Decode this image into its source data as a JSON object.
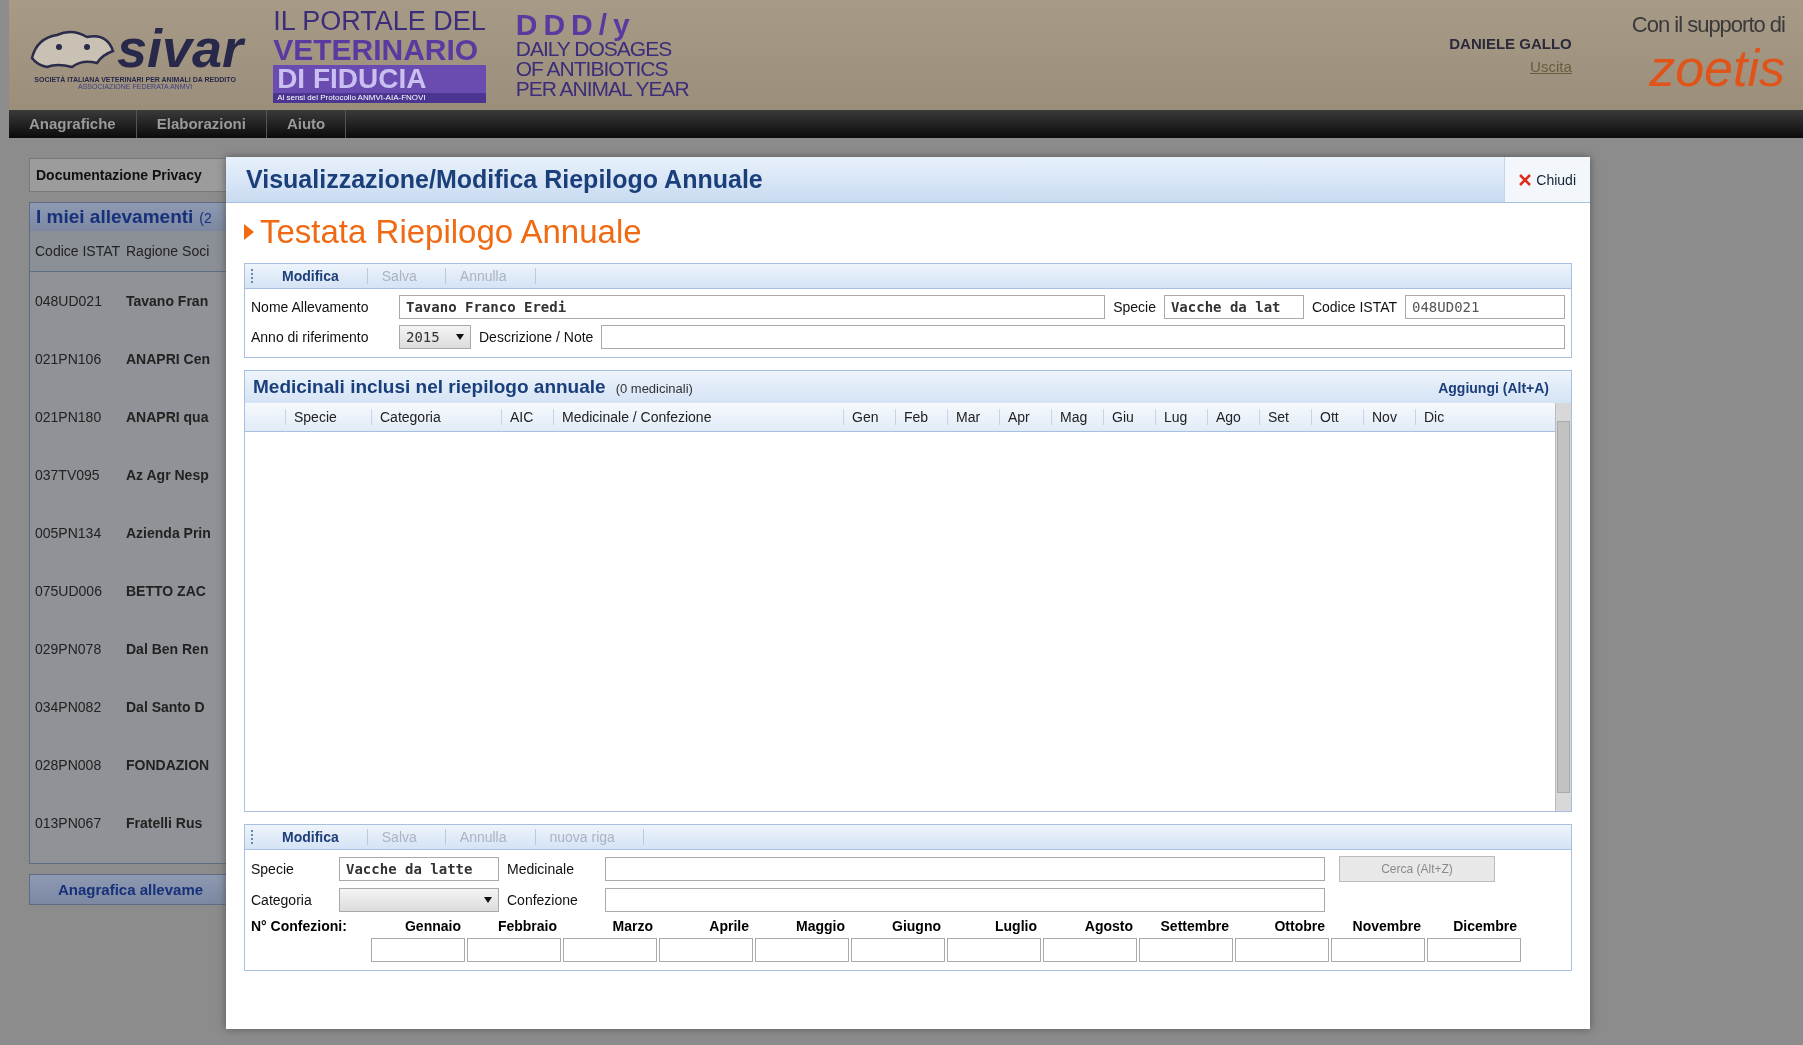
{
  "header": {
    "sivar_logo": {
      "name": "sivar",
      "subtitle": "SOCIETÀ ITALIANA VETERINARI PER ANIMALI DA REDDITO",
      "federation": "ASSOCIAZIONE FEDERATA ANMVI"
    },
    "portal_logo": {
      "line_1": "IL PORTALE DEL",
      "line_2": "VETERINARIO",
      "line_3": "DI FIDUCIA",
      "caption": "Al sensi del Protocollo ANMVI-AIA-FNOVI"
    },
    "ddd_logo": {
      "title": "DDD/y",
      "lines": [
        "DAILY DOSAGES",
        "OF ANTIBIOTICS",
        "PER ANIMAL YEAR"
      ]
    },
    "user": "DANIELE GALLO",
    "logout": "Uscita",
    "sponsor_caption": "Con il supporto di",
    "sponsor": "zoetis"
  },
  "menu": [
    "Anagrafiche",
    "Elaborazioni",
    "Aiuto"
  ],
  "sidebar": {
    "privacy": "Documentazione Privacy",
    "title": "I miei allevamenti",
    "count": "(2",
    "columns": [
      "Codice ISTAT",
      "Ragione Soci"
    ],
    "rows": [
      {
        "code": "048UD021",
        "name": "Tavano Fran"
      },
      {
        "code": "021PN106",
        "name": "ANAPRI Cen"
      },
      {
        "code": "021PN180",
        "name": "ANAPRI qua"
      },
      {
        "code": "037TV095",
        "name": "Az Agr Nesp"
      },
      {
        "code": "005PN134",
        "name": "Azienda Prin"
      },
      {
        "code": "075UD006",
        "name": "BETTO ZAC"
      },
      {
        "code": "029PN078",
        "name": "Dal Ben Ren"
      },
      {
        "code": "034PN082",
        "name": "Dal Santo D"
      },
      {
        "code": "028PN008",
        "name": "FONDAZION"
      },
      {
        "code": "013PN067",
        "name": "Fratelli Rus"
      }
    ],
    "button": "Anagrafica allevame"
  },
  "dialog": {
    "title": "Visualizzazione/Modifica Riepilogo Annuale",
    "close": "Chiudi",
    "heading": "Testata Riepilogo Annuale",
    "toolbar": [
      {
        "label": "Modifica",
        "disabled": false
      },
      {
        "label": "Salva",
        "disabled": true
      },
      {
        "label": "Annulla",
        "disabled": true
      }
    ],
    "form": {
      "name_label": "Nome Allevamento",
      "name_value": "Tavano Franco Eredi",
      "species_label": "Specie",
      "species_value": "Vacche da lat",
      "istat_label": "Codice ISTAT",
      "istat_value": "048UD021",
      "year_label": "Anno di riferimento",
      "year_value": "2015",
      "notes_label": "Descrizione / Note"
    },
    "table": {
      "title": "Medicinali inclusi nel riepilogo annuale",
      "count": "(0 medicinali)",
      "add": "Aggiungi (Alt+A)",
      "columns": [
        "Specie",
        "Categoria",
        "AIC",
        "Medicinale / Confezione",
        "Gen",
        "Feb",
        "Mar",
        "Apr",
        "Mag",
        "Giu",
        "Lug",
        "Ago",
        "Set",
        "Ott",
        "Nov",
        "Dic"
      ]
    },
    "row_toolbar": [
      {
        "label": "Modifica",
        "disabled": false
      },
      {
        "label": "Salva",
        "disabled": true
      },
      {
        "label": "Annulla",
        "disabled": true
      },
      {
        "label": "nuova riga",
        "disabled": true
      }
    ],
    "row_form": {
      "species_label": "Specie",
      "species_value": "Vacche da latte",
      "medicine_label": "Medicinale",
      "search": {
        "label": "Cerca (Alt+Z)",
        "disabled": true
      },
      "category_label": "Categoria",
      "package_label": "Confezione",
      "count_label": "N° Confezioni:",
      "months": [
        "Gennaio",
        "Febbraio",
        "Marzo",
        "Aprile",
        "Maggio",
        "Giugno",
        "Luglio",
        "Agosto",
        "Settembre",
        "Ottobre",
        "Novembre",
        "Dicembre"
      ]
    }
  }
}
